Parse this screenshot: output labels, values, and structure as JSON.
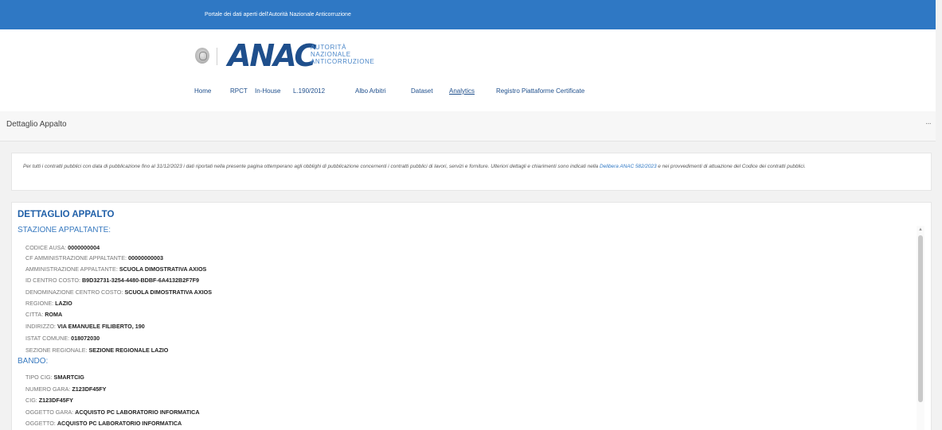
{
  "topbar": {
    "text": "Portale dei dati aperti dell'Autorità Nazionale Anticorruzione"
  },
  "logo": {
    "mark": "ANAC",
    "line1": "AUTORITÀ",
    "line2": "NAZIONALE",
    "line3": "ANTICORRUZIONE"
  },
  "nav": [
    "Home",
    "RPCT",
    "In-House",
    "L.190/2012",
    "Albo Arbitri",
    "Dataset",
    "Analytics",
    "Registro Piattaforme Certificate"
  ],
  "page": {
    "title": "Dettaglio Appalto",
    "more": "···"
  },
  "notice": {
    "text_before": "Per tutti i contratti pubblici con data di pubblicazione fino al 31/12/2023 i dati riportati nella presente pagina ottemperano agli obblighi di pubblicazione concernenti i contratti pubblici di lavori, servizi e forniture. Ulteriori dettagli e chiarimenti sono indicati nella ",
    "link": "Delibera ANAC 582/2023",
    "text_after": " e nei provvedimenti di attuazione del Codice dei contratti pubblici."
  },
  "detail": {
    "title": "DETTAGLIO APPALTO",
    "section1": "STAZIONE APPALTANTE:",
    "stazione": [
      {
        "label": "CODICE AUSA:",
        "value": "0000000004"
      },
      {
        "label": "CF AMMINISTRAZIONE APPALTANTE:",
        "value": "00000000003"
      },
      {
        "label": "AMMINISTRAZIONE APPALTANTE:",
        "value": "SCUOLA DIMOSTRATIVA AXIOS"
      },
      {
        "label": "ID CENTRO COSTO:",
        "value": "B9D32731-3254-4480-BDBF-6A4132B2F7F9"
      },
      {
        "label": "DENOMINAZIONE CENTRO COSTO:",
        "value": "SCUOLA DIMOSTRATIVA AXIOS"
      },
      {
        "label": "REGIONE:",
        "value": "LAZIO"
      },
      {
        "label": "CITTA:",
        "value": "ROMA"
      },
      {
        "label": "INDIRIZZO:",
        "value": "VIA EMANUELE FILIBERTO, 190"
      },
      {
        "label": "ISTAT COMUNE:",
        "value": "018072030"
      },
      {
        "label": "SEZIONE REGIONALE:",
        "value": "SEZIONE REGIONALE LAZIO"
      }
    ],
    "section2": "BANDO:",
    "bando": [
      {
        "label": "TIPO CIG:",
        "value": "SMARTCIG"
      },
      {
        "label": "NUMERO GARA:",
        "value": "Z123DF45FY"
      },
      {
        "label": "CIG:",
        "value": "Z123DF45FY"
      },
      {
        "label": "OGGETTO GARA:",
        "value": "ACQUISTO PC LABORATORIO INFORMATICA"
      },
      {
        "label": "OGGETTO:",
        "value": "ACQUISTO PC LABORATORIO INFORMATICA"
      }
    ]
  }
}
